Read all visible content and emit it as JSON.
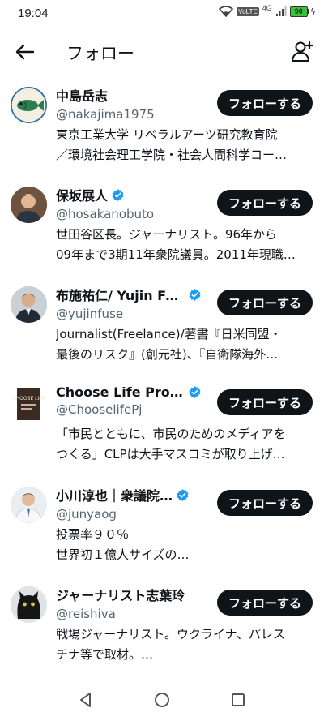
{
  "status": {
    "time": "19:04",
    "network": "4G",
    "volte": "VoLTE",
    "battery": "90"
  },
  "header": {
    "title": "フォロー"
  },
  "users": [
    {
      "name": "中島岳志",
      "handle": "@nakajima1975",
      "verified": false,
      "follow_label": "フォローする",
      "bio": [
        "東京工業大学 リベラルアーツ研究教育院",
        "／環境社会理工学院・社会人間科学コー…"
      ]
    },
    {
      "name": "保坂展人",
      "handle": "@hosakanobuto",
      "verified": true,
      "follow_label": "フォローする",
      "bio": [
        "世田谷区長。ジャーナリスト。96年から",
        "09年まで3期11年衆院議員。2011年現職…"
      ]
    },
    {
      "name": "布施祐仁/ Yujin Fu…",
      "handle": "@yujinfuse",
      "verified": true,
      "follow_label": "フォローする",
      "bio": [
        "Journalist(Freelance)/著書『日米同盟・",
        "最後のリスク』(創元社)、『自衛隊海外…"
      ]
    },
    {
      "name": "Choose Life Project",
      "handle": "@ChooselifePj",
      "verified": true,
      "follow_label": "フォローする",
      "bio": [
        "「市民とともに、市民のためのメディアを",
        "つくる」CLPは大手マスコミが取り上げ…"
      ]
    },
    {
      "name": "小川淳也｜衆議院…",
      "handle": "@junyaog",
      "verified": true,
      "follow_label": "フォローする",
      "bio": [
        "投票率９０％",
        "世界初１億人サイズの…"
      ]
    },
    {
      "name": "ジャーナリスト志葉玲",
      "handle": "@reishiva",
      "verified": false,
      "follow_label": "フォローする",
      "bio": [
        "戦場ジャーナリスト。ウクライナ、パレス",
        "チナ等で取材。…"
      ]
    }
  ],
  "avatar_logo_text": "CHOOSE LIFE"
}
